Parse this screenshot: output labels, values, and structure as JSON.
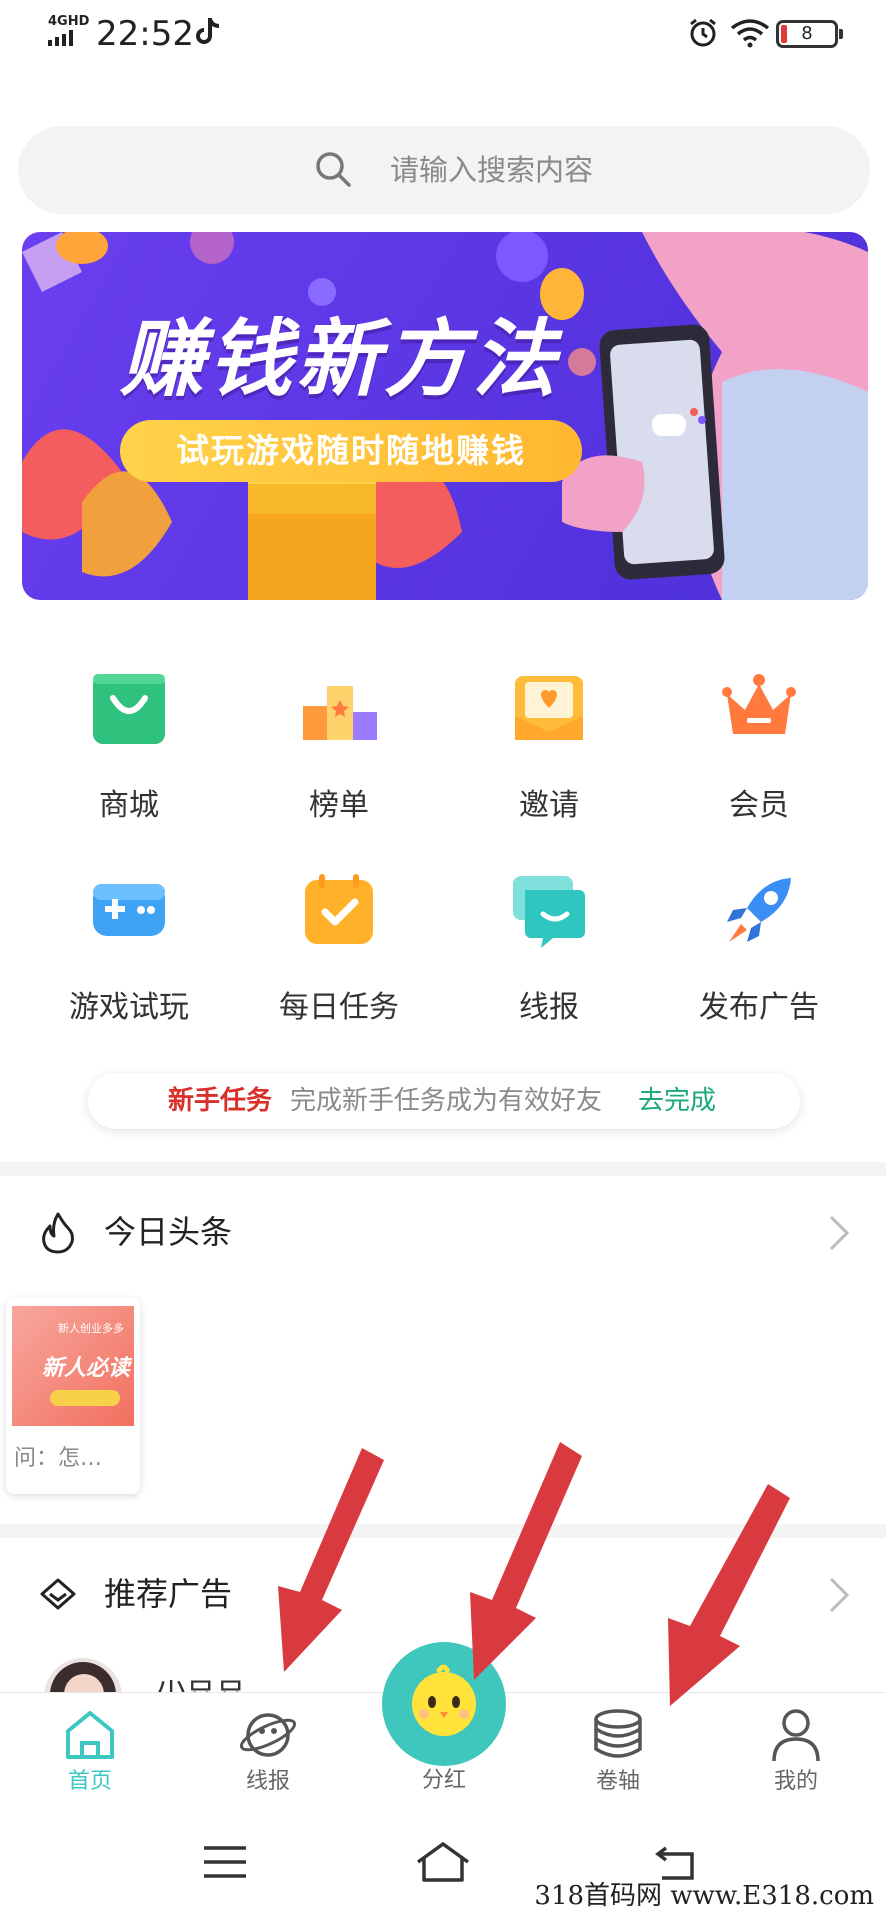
{
  "status_bar": {
    "network": "4GHD",
    "time": "22:52",
    "battery": "8"
  },
  "search": {
    "placeholder": "请输入搜索内容"
  },
  "banner": {
    "title": "赚钱新方法",
    "subtitle": "试玩游戏随时随地赚钱"
  },
  "menu": [
    {
      "label": "商城",
      "icon": "shopping-bag-icon"
    },
    {
      "label": "榜单",
      "icon": "podium-icon"
    },
    {
      "label": "邀请",
      "icon": "invite-envelope-icon"
    },
    {
      "label": "会员",
      "icon": "crown-icon"
    },
    {
      "label": "游戏试玩",
      "icon": "gamepad-icon"
    },
    {
      "label": "每日任务",
      "icon": "calendar-check-icon"
    },
    {
      "label": "线报",
      "icon": "chat-bubble-icon"
    },
    {
      "label": "发布广告",
      "icon": "rocket-icon"
    }
  ],
  "newbie_task": {
    "label": "新手任务",
    "desc": "完成新手任务成为有效好友",
    "action": "去完成"
  },
  "headlines": {
    "title": "今日头条",
    "card": {
      "image_title": "新人必读",
      "image_tag": "新人创业多多",
      "text": "问：怎…"
    }
  },
  "recommended": {
    "title": "推荐广告",
    "peek_text": "小豆豆"
  },
  "tabbar": [
    {
      "label": "首页",
      "icon": "home-icon",
      "active": true
    },
    {
      "label": "线报",
      "icon": "planet-icon",
      "active": false
    },
    {
      "label": "分红",
      "icon": "chick-icon",
      "active": false
    },
    {
      "label": "卷轴",
      "icon": "coin-stack-icon",
      "active": false
    },
    {
      "label": "我的",
      "icon": "user-icon",
      "active": false
    }
  ],
  "watermark": "318首码网 www.E318.com",
  "colors": {
    "accent": "#3cc7c0",
    "banner_bg": "#5a36e3",
    "task_red": "#d9302a",
    "task_green": "#1aa87c",
    "arrow_red": "#d83a3f"
  }
}
